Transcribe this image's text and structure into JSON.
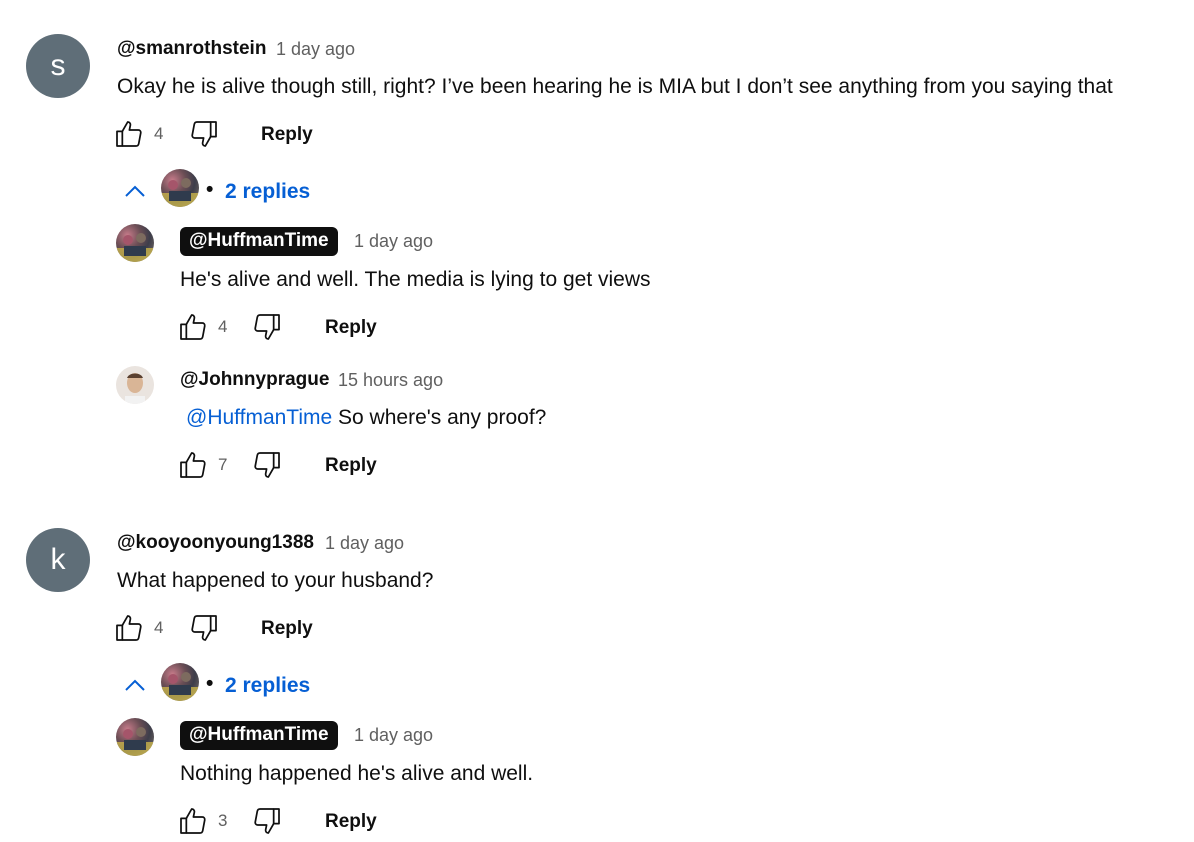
{
  "comments": [
    {
      "avatar_letter": "s",
      "handle": "@smanrothstein",
      "time": "1 day ago",
      "text": "Okay he is alive though still, right? I’ve been hearing he is MIA but I don’t see anything from you saying that",
      "likes": "4",
      "reply_label": "Reply",
      "replies_toggle": "2 replies",
      "replies_dot": "•",
      "replies": [
        {
          "handle": "@HuffmanTime",
          "time": "1 day ago",
          "text": "He's alive and well.  The media is lying to get views",
          "likes": "4",
          "reply_label": "Reply"
        },
        {
          "handle": "@Johnnyprague",
          "time": "15 hours ago",
          "mention": "@HuffmanTime",
          "text": " So where's any proof?",
          "likes": "7",
          "reply_label": "Reply"
        }
      ]
    },
    {
      "avatar_letter": "k",
      "handle": "@kooyoonyoung1388",
      "time": "1 day ago",
      "text": "What happened to your husband?",
      "likes": "4",
      "reply_label": "Reply",
      "replies_toggle": "2 replies",
      "replies_dot": "•",
      "replies": [
        {
          "handle": "@HuffmanTime",
          "time": "1 day ago",
          "text": "Nothing happened he's alive and well.",
          "likes": "3",
          "reply_label": "Reply"
        }
      ]
    }
  ],
  "colors": {
    "link_blue": "#065fd4",
    "text": "#0f0f0f",
    "secondary": "#606060",
    "avatar_bg": "#5f6e78"
  }
}
